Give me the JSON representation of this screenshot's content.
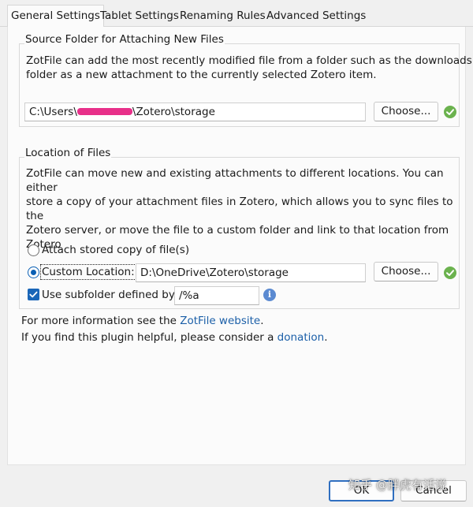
{
  "tabs": [
    {
      "label": "General Settings",
      "active": true
    },
    {
      "label": "Tablet Settings"
    },
    {
      "label": "Renaming Rules"
    },
    {
      "label": "Advanced Settings"
    }
  ],
  "source_folder": {
    "title": "Source Folder for Attaching New Files",
    "description_lines": [
      "ZotFile can add the most recently modified file from a folder such as the downloads",
      "folder as a new attachment to the currently selected Zotero item."
    ],
    "path_prefix": "C:\\Users\\",
    "path_suffix": "\\Zotero\\storage",
    "choose_label": "Choose..."
  },
  "location_of_files": {
    "title": "Location of Files",
    "description_lines": [
      "ZotFile can move new and existing attachments to different locations. You can either",
      "store a copy of your attachment files in Zotero, which allows you to sync files to the",
      "Zotero server, or move the file to a custom folder and link to that location from",
      "Zotero"
    ],
    "option_stored_label": "Attach stored copy of file(s)",
    "option_custom_label": "Custom Location:",
    "custom_path": "D:\\OneDrive\\Zotero\\storage",
    "choose_label": "Choose...",
    "subfolder_label": "Use subfolder defined by",
    "subfolder_value": "/%a",
    "subfolder_checked": true,
    "selected_option": "custom"
  },
  "footer_info": {
    "more_info_prefix": "For more information see the ",
    "more_info_link": "ZotFile website",
    "more_info_suffix": ".",
    "donation_prefix": "If you find this plugin helpful, please consider a ",
    "donation_link": "donation",
    "donation_suffix": "."
  },
  "dialog_buttons": {
    "ok_label": "OK",
    "cancel_label": "Cancel"
  },
  "watermark": "知乎 @胖虎有话说"
}
